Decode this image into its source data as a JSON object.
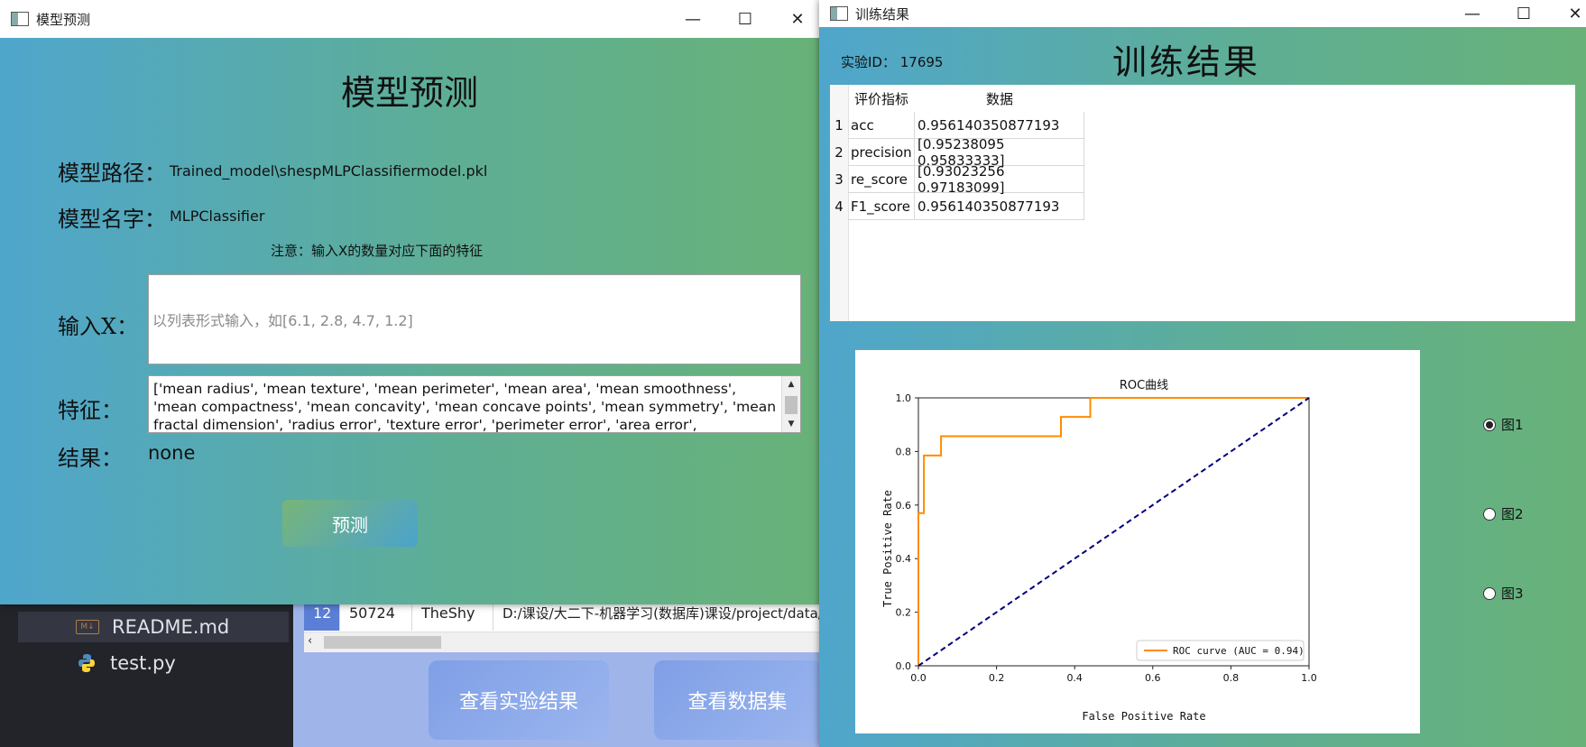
{
  "background": {
    "files": [
      {
        "name": "README.md",
        "icon": "markdown-icon",
        "selected": true
      },
      {
        "name": "test.py",
        "icon": "python-icon",
        "selected": false
      }
    ],
    "table_row": {
      "index": "12",
      "id": "50724",
      "user": "TheShy",
      "path": "D:/课设/大二下-机器学习(数据库)课设/project/data/"
    },
    "buttons": {
      "view_results": "查看实验结果",
      "view_dataset": "查看数据集"
    }
  },
  "predict_window": {
    "title": "模型预测",
    "heading": "模型预测",
    "model_path_label": "模型路径：",
    "model_path_value": "Trained_model\\shespMLPClassifiermodel.pkl",
    "model_name_label": "模型名字：",
    "model_name_value": "MLPClassifier",
    "note": "注意：输入X的数量对应下面的特征",
    "input_label": "输入X：",
    "input_placeholder": "以列表形式输入，如[6.1, 2.8, 4.7, 1.2]",
    "features_label": "特征：",
    "features_text": "['mean radius', 'mean texture', 'mean perimeter', 'mean area', 'mean smoothness', 'mean compactness', 'mean concavity', 'mean concave points', 'mean symmetry', 'mean fractal dimension', 'radius error', 'texture error', 'perimeter error', 'area error', 'smoothness error',",
    "result_label": "结果：",
    "result_value": "none",
    "predict_button": "预测"
  },
  "results_window": {
    "title": "训练结果",
    "heading": "训练结果",
    "experiment_id": "实验ID：  17695",
    "table": {
      "headers": [
        "评价指标",
        "数据"
      ],
      "rows": [
        {
          "num": "1",
          "metric": "acc",
          "value": "0.956140350877193"
        },
        {
          "num": "2",
          "metric": "precision",
          "value": "[0.95238095 0.95833333]"
        },
        {
          "num": "3",
          "metric": "re_score",
          "value": "[0.93023256 0.97183099]"
        },
        {
          "num": "4",
          "metric": "F1_score",
          "value": "0.956140350877193"
        }
      ]
    },
    "radios": [
      {
        "label": "图1",
        "checked": true
      },
      {
        "label": "图2",
        "checked": false
      },
      {
        "label": "图3",
        "checked": false
      }
    ]
  },
  "chart_data": {
    "type": "line",
    "title": "ROC曲线",
    "xlabel": "False Positive Rate",
    "ylabel": "True Positive Rate",
    "xlim": [
      0.0,
      1.0
    ],
    "ylim": [
      0.0,
      1.0
    ],
    "xticks": [
      "0.0",
      "0.2",
      "0.4",
      "0.6",
      "0.8",
      "1.0"
    ],
    "yticks": [
      "0.0",
      "0.2",
      "0.4",
      "0.6",
      "0.8",
      "1.0"
    ],
    "legend": "bottom-right",
    "series": [
      {
        "name": "ROC curve (AUC = 0.94)",
        "color": "#ff8c00",
        "style": "step",
        "x": [
          0.0,
          0.0,
          0.014,
          0.014,
          0.058,
          0.058,
          0.365,
          0.365,
          0.44,
          0.44,
          1.0
        ],
        "y": [
          0.0,
          0.57,
          0.57,
          0.785,
          0.785,
          0.857,
          0.857,
          0.929,
          0.929,
          1.0,
          1.0
        ]
      },
      {
        "name": "",
        "color": "#000080",
        "style": "dashed",
        "x": [
          0.0,
          1.0
        ],
        "y": [
          0.0,
          1.0
        ]
      }
    ]
  }
}
